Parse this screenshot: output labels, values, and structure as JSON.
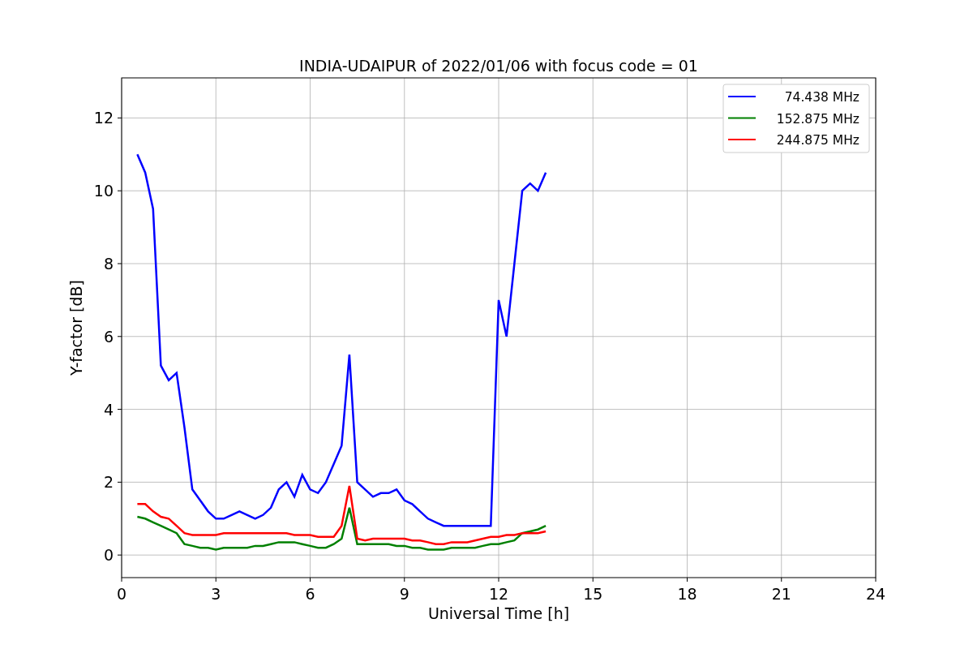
{
  "figure": {
    "chart_data": {
      "type": "line",
      "title": "INDIA-UDAIPUR of 2022/01/06 with focus code = 01",
      "xlabel": "Universal Time [h]",
      "ylabel": "Y-factor [dB]",
      "x": [
        0.5,
        0.75,
        1.0,
        1.25,
        1.5,
        1.75,
        2.0,
        2.25,
        2.5,
        2.75,
        3.0,
        3.25,
        3.5,
        3.75,
        4.0,
        4.25,
        4.5,
        4.75,
        5.0,
        5.25,
        5.5,
        5.75,
        6.0,
        6.25,
        6.5,
        6.75,
        7.0,
        7.25,
        7.5,
        7.75,
        8.0,
        8.25,
        8.5,
        8.75,
        9.0,
        9.25,
        9.5,
        9.75,
        10.0,
        10.25,
        10.5,
        10.75,
        11.0,
        11.25,
        11.5,
        11.75,
        12.0,
        12.25,
        12.5,
        12.75,
        13.0,
        13.25,
        13.5
      ],
      "series": [
        {
          "name": "74.438 MHz",
          "color": "#0000ff",
          "values": [
            11,
            10.5,
            9.5,
            5.2,
            4.8,
            5.0,
            3.5,
            1.8,
            1.5,
            1.2,
            1.0,
            1.0,
            1.1,
            1.2,
            1.1,
            1.0,
            1.1,
            1.3,
            1.8,
            2.0,
            1.6,
            2.2,
            1.8,
            1.7,
            2.0,
            2.5,
            3.0,
            5.5,
            2.0,
            1.8,
            1.6,
            1.7,
            1.7,
            1.8,
            1.5,
            1.4,
            1.2,
            1.0,
            0.9,
            0.8,
            0.8,
            0.8,
            0.8,
            0.8,
            0.8,
            0.8,
            7.0,
            6.0,
            8.0,
            10.0,
            10.2,
            10.0,
            10.5
          ]
        },
        {
          "name": "152.875 MHz",
          "color": "#008000",
          "values": [
            1.05,
            1.0,
            0.9,
            0.8,
            0.7,
            0.6,
            0.3,
            0.25,
            0.2,
            0.2,
            0.15,
            0.2,
            0.2,
            0.2,
            0.2,
            0.25,
            0.25,
            0.3,
            0.35,
            0.35,
            0.35,
            0.3,
            0.25,
            0.2,
            0.2,
            0.3,
            0.45,
            1.3,
            0.3,
            0.3,
            0.3,
            0.3,
            0.3,
            0.25,
            0.25,
            0.2,
            0.2,
            0.15,
            0.15,
            0.15,
            0.2,
            0.2,
            0.2,
            0.2,
            0.25,
            0.3,
            0.3,
            0.35,
            0.4,
            0.6,
            0.65,
            0.7,
            0.8
          ]
        },
        {
          "name": "244.875 MHz",
          "color": "#ff0000",
          "values": [
            1.4,
            1.4,
            1.2,
            1.05,
            1.0,
            0.8,
            0.6,
            0.55,
            0.55,
            0.55,
            0.55,
            0.6,
            0.6,
            0.6,
            0.6,
            0.6,
            0.6,
            0.6,
            0.6,
            0.6,
            0.55,
            0.55,
            0.55,
            0.5,
            0.5,
            0.5,
            0.8,
            1.9,
            0.45,
            0.4,
            0.45,
            0.45,
            0.45,
            0.45,
            0.45,
            0.4,
            0.4,
            0.35,
            0.3,
            0.3,
            0.35,
            0.35,
            0.35,
            0.4,
            0.45,
            0.5,
            0.5,
            0.55,
            0.55,
            0.6,
            0.6,
            0.6,
            0.65
          ]
        }
      ],
      "grid": true,
      "legend": true,
      "xlim": [
        0,
        24
      ],
      "ylim": [
        -0.62,
        13.1
      ],
      "xticks": [
        0,
        3,
        6,
        9,
        12,
        15,
        18,
        21,
        24
      ],
      "yticks": [
        0,
        2,
        4,
        6,
        8,
        10,
        12
      ]
    }
  }
}
